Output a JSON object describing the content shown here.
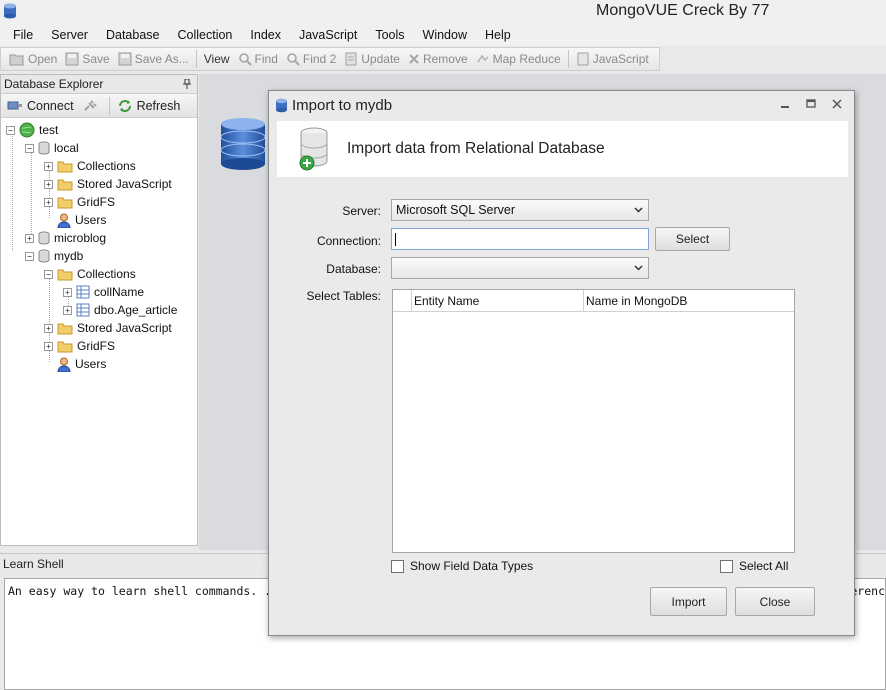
{
  "window": {
    "title": "MongoVUE Creck By 77"
  },
  "menu": [
    "File",
    "Server",
    "Database",
    "Collection",
    "Index",
    "JavaScript",
    "Tools",
    "Window",
    "Help"
  ],
  "toolbar": {
    "open": "Open",
    "save": "Save",
    "save_as": "Save As...",
    "view": "View",
    "find": "Find",
    "find2": "Find 2",
    "update": "Update",
    "remove": "Remove",
    "map_reduce": "Map Reduce",
    "javascript": "JavaScript"
  },
  "explorer": {
    "title": "Database Explorer",
    "pin": "ᵖ",
    "connect": "Connect",
    "refresh": "Refresh",
    "tree": {
      "server": "test",
      "db_local": "local",
      "local_collections": "Collections",
      "local_js": "Stored JavaScript",
      "local_gridfs": "GridFS",
      "local_users": "Users",
      "db_microblog": "microblog",
      "db_mydb": "mydb",
      "mydb_collections": "Collections",
      "coll1": "collName",
      "coll2": "dbo.Age_article",
      "mydb_js": "Stored JavaScript",
      "mydb_gridfs": "GridFS",
      "mydb_users": "Users"
    }
  },
  "shell": {
    "title": "Learn Shell",
    "text": "An easy way to learn shell commands. ..",
    "text_right": "erenc"
  },
  "dialog": {
    "title": "Import to mydb",
    "banner": "Import data from Relational Database",
    "server_label": "Server:",
    "server_value": "Microsoft SQL Server",
    "connection_label": "Connection:",
    "connection_value": "",
    "select_button": "Select",
    "database_label": "Database:",
    "database_value": "",
    "tables_label": "Select Tables:",
    "col_entity": "Entity Name",
    "col_mongo": "Name in MongoDB",
    "show_types": "Show Field Data Types",
    "select_all": "Select All",
    "import_button": "Import",
    "close_button": "Close"
  }
}
